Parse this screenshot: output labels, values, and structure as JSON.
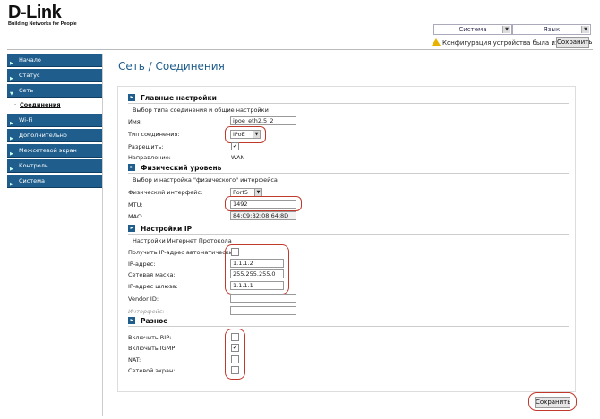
{
  "brand": {
    "name": "D-Link",
    "tagline": "Building Networks for People"
  },
  "topbar": {
    "system_menu": "Система",
    "language_menu": "Язык",
    "config_changed": "Конфигурация устройства была изменена",
    "save_label": "Сохранить"
  },
  "sidebar": {
    "items": [
      {
        "label": "Начало",
        "icon": "arrow-right-icon"
      },
      {
        "label": "Статус",
        "icon": "arrow-right-icon"
      },
      {
        "label": "Сеть",
        "icon": "arrow-down-icon"
      },
      {
        "label": "Wi-Fi",
        "icon": "arrow-right-icon"
      },
      {
        "label": "Дополнительно",
        "icon": "arrow-right-icon"
      },
      {
        "label": "Межсетевой экран",
        "icon": "arrow-right-icon"
      },
      {
        "label": "Контроль",
        "icon": "arrow-right-icon"
      },
      {
        "label": "Система",
        "icon": "arrow-right-icon"
      }
    ],
    "sub_item": "Соединения"
  },
  "page": {
    "title": "Сеть / Соединения"
  },
  "main_settings": {
    "heading": "Главные настройки",
    "description": "Выбор типа соединения и общие настройки",
    "name_label": "Имя:",
    "name_value": "ipoe_eth2.5_2",
    "conn_type_label": "Тип соединения:",
    "conn_type_value": "IPoE",
    "enable_label": "Разрешить:",
    "enable_checked": true,
    "direction_label": "Направление:",
    "direction_value": "WAN"
  },
  "physical": {
    "heading": "Физический уровень",
    "description": "Выбор и настройка \"физического\" интерфейса",
    "iface_label": "Физический интерфейс:",
    "iface_value": "Port5",
    "mtu_label": "MTU:",
    "mtu_value": "1492",
    "mac_label": "MAC:",
    "mac_value": "84:C9:B2:08:64:8D"
  },
  "ip_settings": {
    "heading": "Настройки IP",
    "description": "Настройки Интернет Протокола",
    "auto_label": "Получить IP-адрес автоматически:",
    "auto_checked": false,
    "ip_label": "IP-адрес:",
    "ip_value": "1.1.1.2",
    "mask_label": "Сетевая маска:",
    "mask_value": "255.255.255.0",
    "gw_label": "IP-адрес шлюза:",
    "gw_value": "1.1.1.1",
    "vendor_label": "Vendor ID:",
    "vendor_value": "",
    "iface_label": "Интерфейс:",
    "iface_value": ""
  },
  "misc": {
    "heading": "Разное",
    "rip_label": "Включить RIP:",
    "rip_checked": false,
    "igmp_label": "Включить IGMP:",
    "igmp_checked": true,
    "nat_label": "NAT:",
    "nat_checked": false,
    "firewall_label": "Сетевой экран:",
    "firewall_checked": false
  },
  "footer": {
    "save_label": "Сохранить"
  },
  "colors": {
    "accent": "#1e5d8c",
    "highlight": "#c0392b",
    "warning": "#e8b300"
  }
}
